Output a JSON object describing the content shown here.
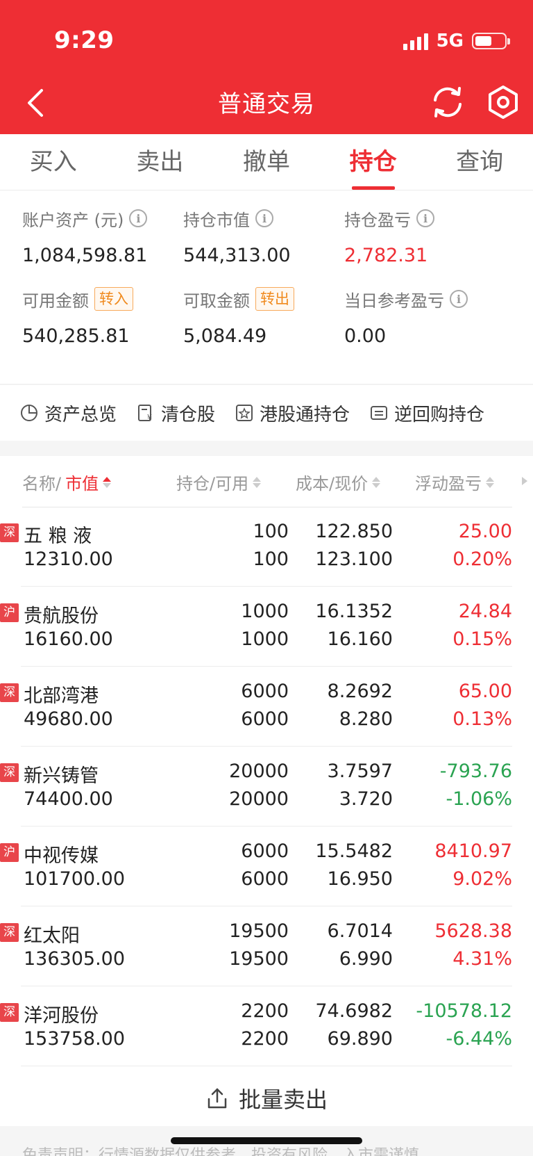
{
  "status": {
    "time": "9:29",
    "network": "5G"
  },
  "header": {
    "title": "普通交易"
  },
  "tabs": [
    {
      "label": "买入",
      "active": false
    },
    {
      "label": "卖出",
      "active": false
    },
    {
      "label": "撤单",
      "active": false
    },
    {
      "label": "持仓",
      "active": true
    },
    {
      "label": "查询",
      "active": false
    }
  ],
  "summary": {
    "account_assets": {
      "label": "账户资产 (元)",
      "value": "1,084,598.81"
    },
    "position_value": {
      "label": "持仓市值",
      "value": "544,313.00"
    },
    "position_pnl": {
      "label": "持仓盈亏",
      "value": "2,782.31"
    },
    "available": {
      "label": "可用金额",
      "tag": "转入",
      "value": "540,285.81"
    },
    "withdrawable": {
      "label": "可取金额",
      "tag": "转出",
      "value": "5,084.49"
    },
    "daily_pnl": {
      "label": "当日参考盈亏",
      "value": "0.00"
    }
  },
  "quick_links": [
    {
      "label": "资产总览",
      "icon": "pie-chart-icon"
    },
    {
      "label": "清仓股",
      "icon": "cleared-stock-icon"
    },
    {
      "label": "港股通持仓",
      "icon": "hk-connect-icon"
    },
    {
      "label": "逆回购持仓",
      "icon": "reverse-repo-icon"
    }
  ],
  "table": {
    "headers": {
      "name_a": "名称/",
      "name_b": "市值",
      "qty": "持仓/可用",
      "price": "成本/现价",
      "pnl": "浮动盈亏"
    },
    "rows": [
      {
        "market": "深",
        "name": "五 粮 液",
        "value": "12310.00",
        "qty": "100",
        "avail": "100",
        "cost": "122.850",
        "price": "123.100",
        "pnl": "25.00",
        "pct": "0.20%",
        "dir": "pos"
      },
      {
        "market": "沪",
        "name": "贵航股份",
        "value": "16160.00",
        "qty": "1000",
        "avail": "1000",
        "cost": "16.1352",
        "price": "16.160",
        "pnl": "24.84",
        "pct": "0.15%",
        "dir": "pos"
      },
      {
        "market": "深",
        "name": "北部湾港",
        "value": "49680.00",
        "qty": "6000",
        "avail": "6000",
        "cost": "8.2692",
        "price": "8.280",
        "pnl": "65.00",
        "pct": "0.13%",
        "dir": "pos"
      },
      {
        "market": "深",
        "name": "新兴铸管",
        "value": "74400.00",
        "qty": "20000",
        "avail": "20000",
        "cost": "3.7597",
        "price": "3.720",
        "pnl": "-793.76",
        "pct": "-1.06%",
        "dir": "neg"
      },
      {
        "market": "沪",
        "name": "中视传媒",
        "value": "101700.00",
        "qty": "6000",
        "avail": "6000",
        "cost": "15.5482",
        "price": "16.950",
        "pnl": "8410.97",
        "pct": "9.02%",
        "dir": "pos"
      },
      {
        "market": "深",
        "name": "红太阳",
        "value": "136305.00",
        "qty": "19500",
        "avail": "19500",
        "cost": "6.7014",
        "price": "6.990",
        "pnl": "5628.38",
        "pct": "4.31%",
        "dir": "pos"
      },
      {
        "market": "深",
        "name": "洋河股份",
        "value": "153758.00",
        "qty": "2200",
        "avail": "2200",
        "cost": "74.6982",
        "price": "69.890",
        "pnl": "-10578.12",
        "pct": "-6.44%",
        "dir": "neg"
      }
    ]
  },
  "batch_sell": {
    "label": "批量卖出"
  },
  "footer": {
    "text": "免责声明：行情源数据仅供参考，投资有风险，入市需谨慎"
  },
  "colors": {
    "brand": "#ee2e34",
    "up": "#ee2e34",
    "down": "#2aa351",
    "tag": "#f08a1e"
  }
}
